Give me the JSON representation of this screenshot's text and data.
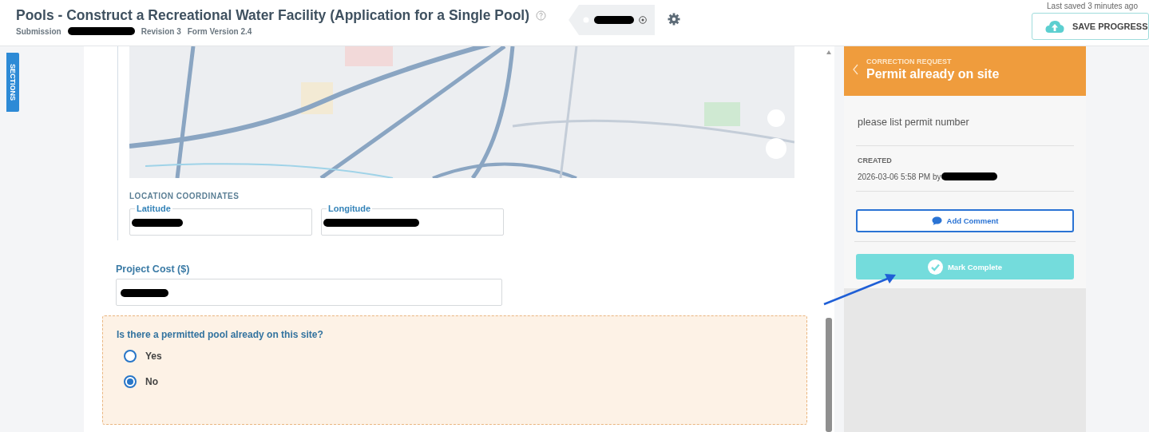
{
  "header": {
    "title": "Pools - Construct a Recreational Water Facility (Application for a Single Pool)",
    "submission_label": "Submission",
    "revision": "Revision 3",
    "form_version": "Form Version 2.4",
    "last_saved": "Last saved 3 minutes ago",
    "save_button": "SAVE PROGRESS"
  },
  "sections_tab": "SECTIONS",
  "location": {
    "heading": "LOCATION COORDINATES",
    "fields": [
      {
        "label": "Latitude"
      },
      {
        "label": "Longitude"
      }
    ]
  },
  "project_cost": {
    "label": "Project Cost ($)"
  },
  "question": {
    "text": "Is there a permitted pool already on this site?",
    "options": [
      {
        "label": "Yes",
        "selected": false
      },
      {
        "label": "No",
        "selected": true
      }
    ]
  },
  "correction": {
    "eyebrow": "CORRECTION REQUEST",
    "title": "Permit already on site",
    "message": "please list permit number",
    "created_label": "CREATED",
    "created_value": "2026-03-06 5:58 PM by",
    "buttons": [
      {
        "label": "Add Comment",
        "kind": "outline"
      },
      {
        "label": "Mark Complete",
        "kind": "complete"
      }
    ]
  }
}
